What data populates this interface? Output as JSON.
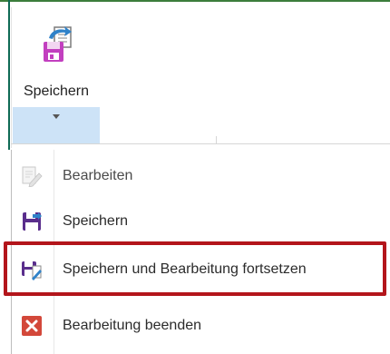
{
  "ribbon": {
    "save_label": "Speichern"
  },
  "menu": {
    "items": [
      {
        "label": "Bearbeiten",
        "icon": "edit-document-icon",
        "enabled": false
      },
      {
        "label": "Speichern",
        "icon": "save-floppy-icon",
        "enabled": true
      },
      {
        "label": "Speichern und Bearbeitung fortsetzen",
        "icon": "save-and-edit-icon",
        "enabled": true
      },
      {
        "label": "Bearbeitung beenden",
        "icon": "close-edit-icon",
        "enabled": true
      }
    ]
  },
  "colors": {
    "accent_purple": "#5a2e8c",
    "save_magenta": "#c23fbf",
    "close_red": "#d3483a",
    "highlight_red": "#b3151b",
    "dropdown_selected": "#cde3f7"
  }
}
